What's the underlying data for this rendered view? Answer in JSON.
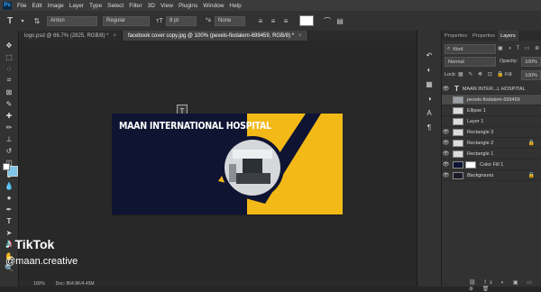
{
  "menu": {
    "logo": "Ps",
    "items": [
      "File",
      "Edit",
      "Image",
      "Layer",
      "Type",
      "Select",
      "Filter",
      "3D",
      "View",
      "Plugins",
      "Window",
      "Help"
    ]
  },
  "options": {
    "font_family": "Anton",
    "font_style": "Regular",
    "font_size": "8 pt",
    "antialias": "None"
  },
  "tabs": [
    {
      "label": "logo.psd @ 66.7% (2825, RGB/8) *"
    },
    {
      "label": "facebook cover copy.jpg @ 100% (pexels-fiodalem-699459, RGB/8) *"
    }
  ],
  "document": {
    "hospital_title": "MAAN INTERNATIONAL HOSPITAL",
    "navy": "#0f1433",
    "yellow": "#f3b917"
  },
  "status": {
    "zoom": "100%",
    "doc_info": "Doc: 864.8K/4.45M"
  },
  "panel": {
    "tabs": [
      "Properties",
      "Properties",
      "Layers"
    ],
    "filter_label": "Kind",
    "blend_mode": "Normal",
    "opacity_label": "Opacity:",
    "opacity_value": "100%",
    "lock_label": "Lock:",
    "fill_label": "Fill:",
    "fill_value": "100%",
    "layers": [
      {
        "name": "MAAN INTER...L HOSPITAL",
        "type": "text"
      },
      {
        "name": "pexels-fiodalem-699459",
        "type": "image"
      },
      {
        "name": "Ellipse 1",
        "type": "shape"
      },
      {
        "name": "Layer 1",
        "type": "shape"
      },
      {
        "name": "Rectangle 3",
        "type": "shape"
      },
      {
        "name": "Rectangle 2",
        "type": "shape"
      },
      {
        "name": "Rectangle 1",
        "type": "shape"
      },
      {
        "name": "Color Fill 1",
        "type": "fill"
      },
      {
        "name": "Background",
        "type": "bg"
      }
    ]
  },
  "watermark": {
    "brand": "TikTok",
    "handle": "@maan.creative"
  }
}
